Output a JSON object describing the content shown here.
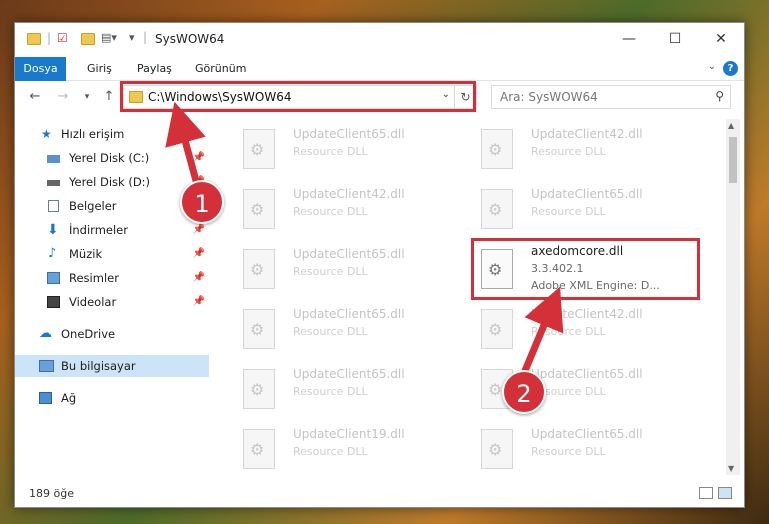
{
  "window": {
    "title": "SysWOW64",
    "minimize": "—",
    "maximize": "☐",
    "close": "✕"
  },
  "ribbon": {
    "tabs": [
      "Dosya",
      "Giriş",
      "Paylaş",
      "Görünüm"
    ],
    "help": "?"
  },
  "nav": {
    "address": "C:\\Windows\\SysWOW64",
    "search_placeholder": "Ara: SysWOW64"
  },
  "sidebar": {
    "items": [
      {
        "label": "Hızlı erişim",
        "icon": "star-icon"
      },
      {
        "label": "Yerel Disk (C:)",
        "icon": "drive-icon"
      },
      {
        "label": "Yerel Disk (D:)",
        "icon": "drive-icon"
      },
      {
        "label": "Belgeler",
        "icon": "documents-icon"
      },
      {
        "label": "İndirmeler",
        "icon": "download-icon"
      },
      {
        "label": "Müzik",
        "icon": "music-icon"
      },
      {
        "label": "Resimler",
        "icon": "pictures-icon"
      },
      {
        "label": "Videolar",
        "icon": "video-icon"
      },
      {
        "label": "OneDrive",
        "icon": "cloud-icon"
      },
      {
        "label": "Bu bilgisayar",
        "icon": "computer-icon"
      },
      {
        "label": "Ağ",
        "icon": "network-icon"
      }
    ]
  },
  "files": [
    {
      "name": "UpdateClient65.dll",
      "type": "Resource DLL"
    },
    {
      "name": "UpdateClient42.dll",
      "type": "Resource DLL"
    },
    {
      "name": "UpdateClient42.dll",
      "type": "Resource DLL"
    },
    {
      "name": "UpdateClient65.dll",
      "type": "Resource DLL"
    },
    {
      "name": "UpdateClient65.dll",
      "type": "Resource DLL"
    },
    {
      "name": "axedomcore.dll",
      "version": "3.3.402.1",
      "description": "Adobe XML Engine: D..."
    },
    {
      "name": "UpdateClient65.dll",
      "type": "Resource DLL"
    },
    {
      "name": "UpdateClient42.dll",
      "type": "Resource DLL"
    },
    {
      "name": "UpdateClient65.dll",
      "type": "Resource DLL"
    },
    {
      "name": "UpdateClient65.dll",
      "type": "Resource DLL"
    },
    {
      "name": "UpdateClient65.dll",
      "type": "Resource DLL"
    },
    {
      "name": "UpdateClient65.dll",
      "type": "Resource DLL"
    },
    {
      "name": "UpdateClient19.dll",
      "type": "Resource DLL"
    },
    {
      "name": "UpdateClient65.dll",
      "type": "Resource DLL"
    }
  ],
  "status": {
    "count": "189 öğe"
  },
  "callouts": [
    "1",
    "2"
  ],
  "colors": {
    "accent": "#1979ca",
    "highlight": "#d3303a",
    "selected": "#cce4f7"
  }
}
